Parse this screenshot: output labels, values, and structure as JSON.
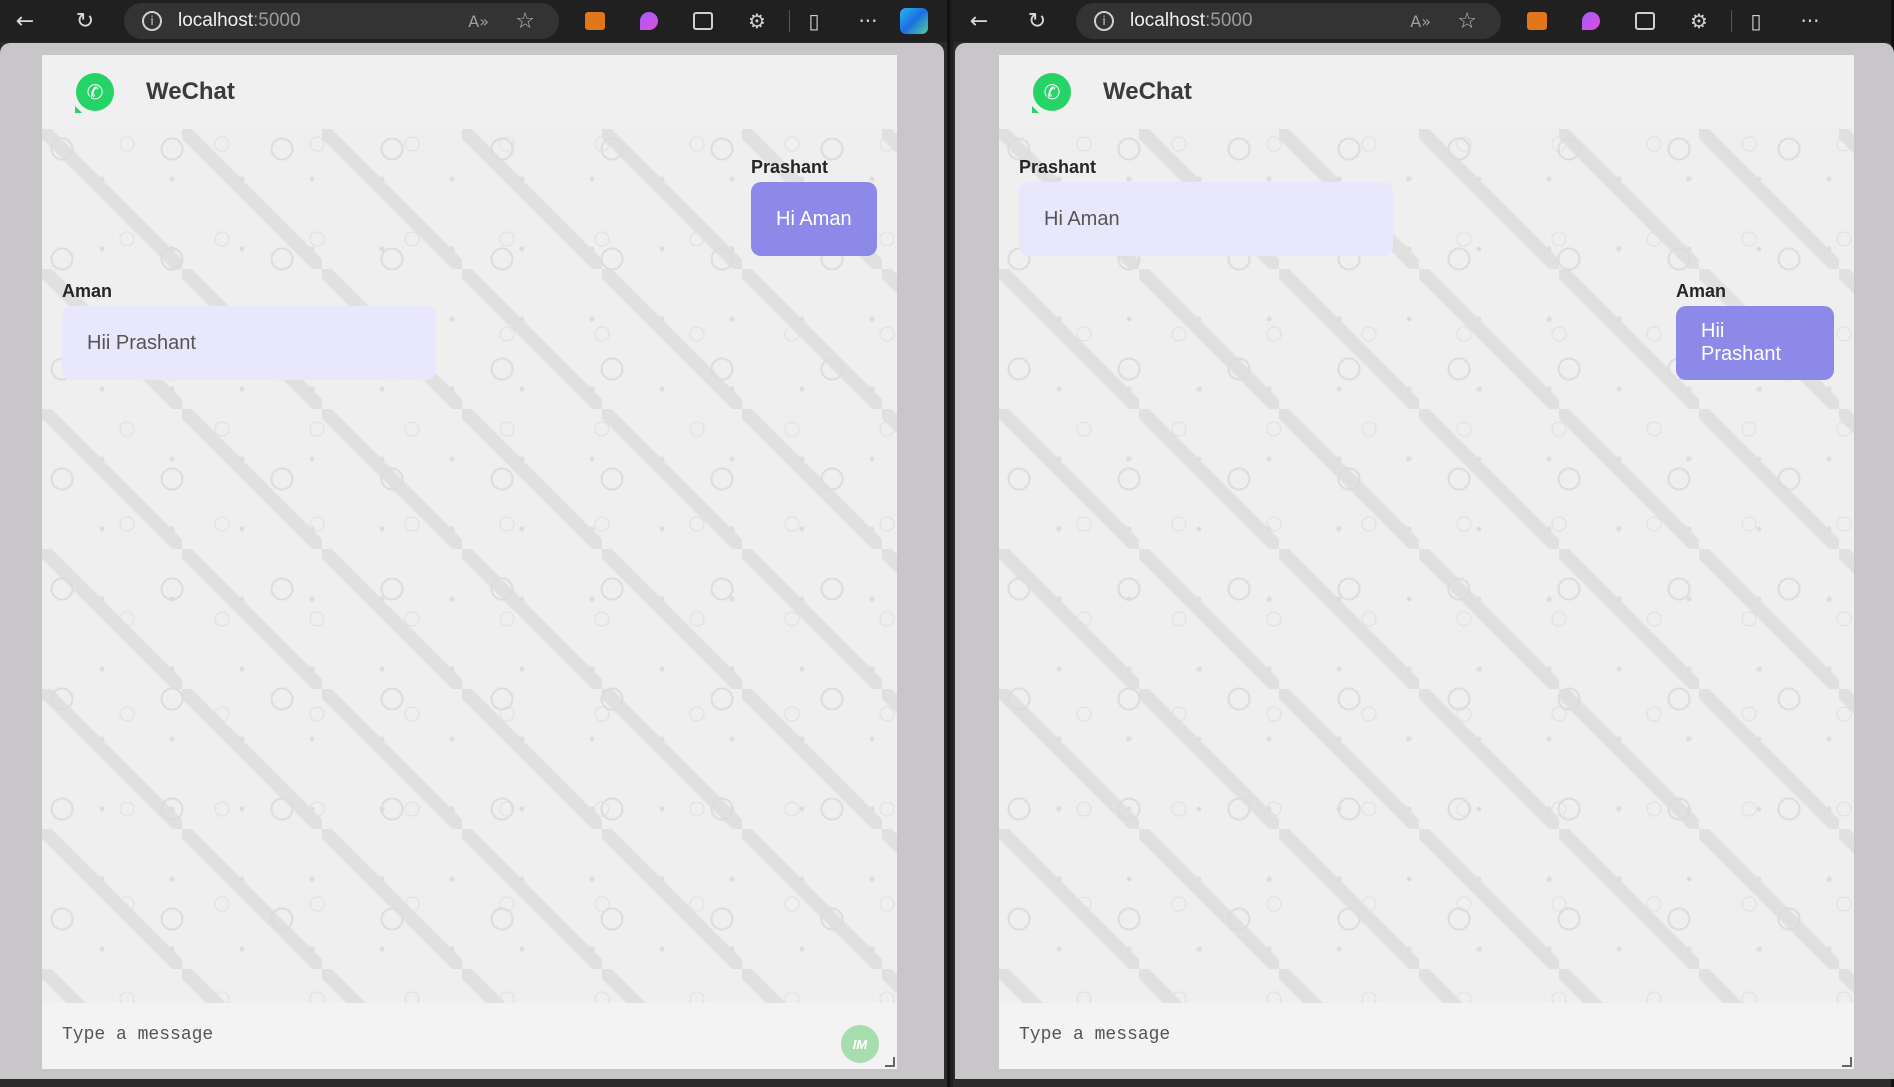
{
  "browser": {
    "address_host": "localhost",
    "address_port": ":5000",
    "read_aloud_icon": "read-aloud-icon",
    "favorite_icon": "star-icon",
    "more_label": "···"
  },
  "app": {
    "title": "WeChat",
    "logo_icon": "whatsapp-logo-icon",
    "composer_placeholder": "Type a message",
    "avatar_initials": "IM",
    "colors": {
      "outgoing_bubble": "#8c89e8",
      "incoming_bubble": "#e8e7fb",
      "logo": "#25d366"
    }
  },
  "left_window": {
    "messages": [
      {
        "sender": "Prashant",
        "text": "Hi Aman",
        "side": "right"
      },
      {
        "sender": "Aman",
        "text": "Hii Prashant",
        "side": "left"
      }
    ]
  },
  "right_window": {
    "messages": [
      {
        "sender": "Prashant",
        "text": "Hi Aman",
        "side": "left"
      },
      {
        "sender": "Aman",
        "text": "Hii Prashant",
        "side": "right"
      }
    ]
  }
}
